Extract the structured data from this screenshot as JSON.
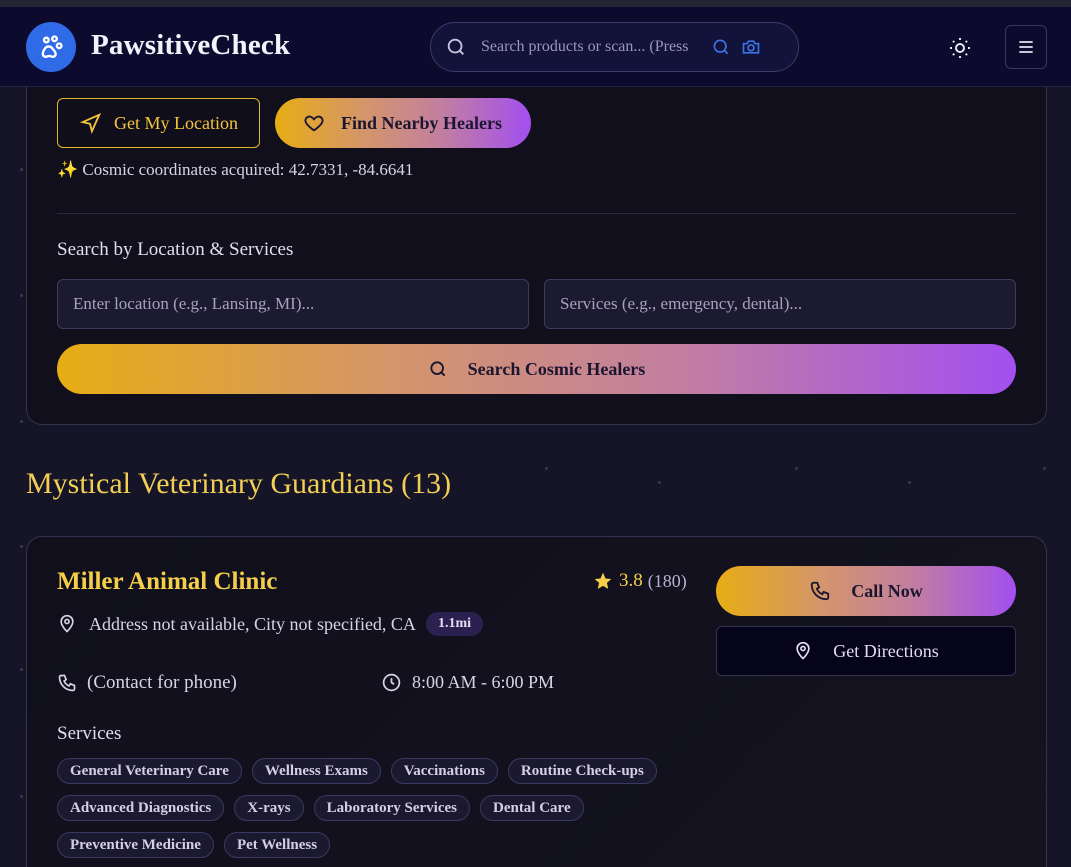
{
  "header": {
    "brand": "PawsitiveCheck",
    "search_placeholder": "Search products or scan... (Press"
  },
  "location": {
    "get_location_label": "Get My Location",
    "find_healers_label": "Find Nearby Healers",
    "coords_text": "✨ Cosmic coordinates acquired: 42.7331, -84.6641"
  },
  "search": {
    "label": "Search by Location & Services",
    "location_placeholder": "Enter location (e.g., Lansing, MI)...",
    "services_placeholder": "Services (e.g., emergency, dental)...",
    "button_label": "Search Cosmic Healers"
  },
  "results": {
    "title": "Mystical Veterinary Guardians (13)"
  },
  "clinic": {
    "name": "Miller Animal Clinic",
    "rating": "3.8",
    "review_count": "(180)",
    "address": "Address not available, City not specified, CA",
    "distance": "1.1mi",
    "phone": "(Contact for phone)",
    "hours": "8:00 AM - 6:00 PM",
    "call_label": "Call Now",
    "directions_label": "Get Directions",
    "services_label": "Services",
    "services": [
      "General Veterinary Care",
      "Wellness Exams",
      "Vaccinations",
      "Routine Check-ups",
      "Advanced Diagnostics",
      "X-rays",
      "Laboratory Services",
      "Dental Care",
      "Preventive Medicine",
      "Pet Wellness"
    ]
  },
  "colors": {
    "accent_gold": "#f5cf4a",
    "accent_purple": "#a24ff0",
    "brand_blue": "#2f6be6"
  }
}
